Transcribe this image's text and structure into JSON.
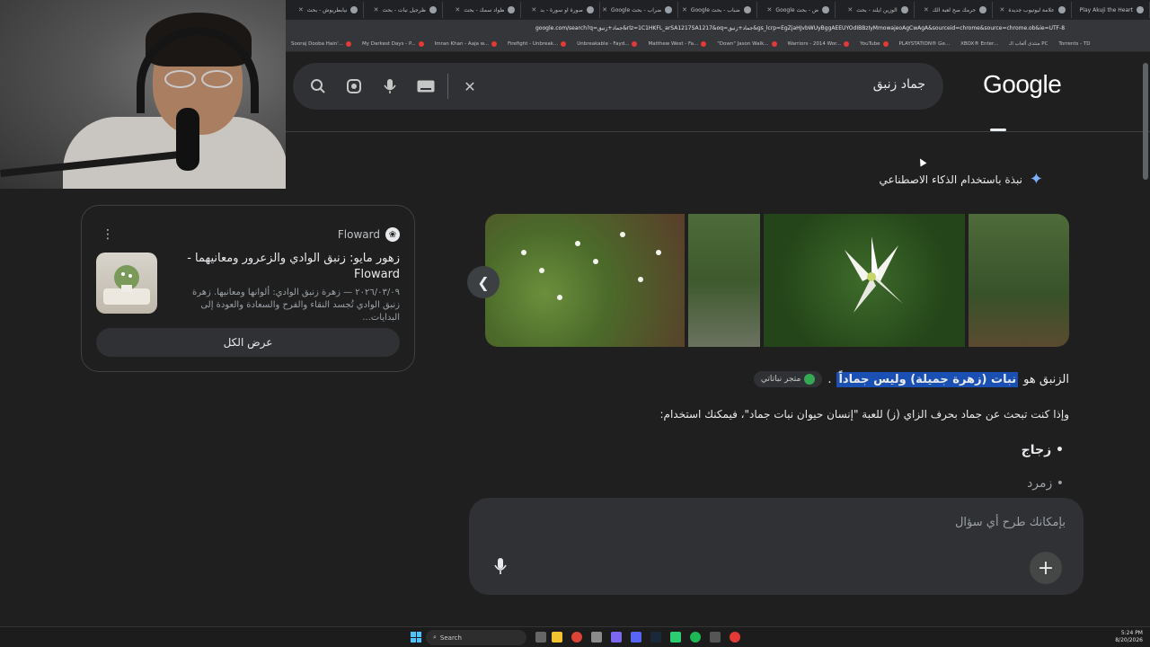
{
  "browser": {
    "tabs": [
      "Play Akuji the Heart",
      "علامة ليوتيوب جديدة",
      "حرمك صح لعبة الك",
      "الوزين ايلند - بحث",
      "ض - بحث Google",
      "ضباب - بحث Google",
      "ضراب - بحث Google",
      "صورة او سورة - بد",
      "ظواد سمك - بحث",
      "ظرجيل نبات - بحث",
      "نيابطريوش - بحث"
    ],
    "url": "google.com/search?q=جماد+زنبق&rlz=1C1HKFL_arSA1217SA1217&oq=جماد+زنبق&gs_lcrp=EgZjaHJvbWUyBggAEEUYOdIBBzIyMmowajeoAgCwAgA&sourceid=chrome&source=chrome.ob&ie=UTF-8",
    "bookmarks": [
      "Torrents - TD",
      "منتدى ألعاب الـ PC",
      "XBOX® Enter...",
      "PLAYSTATION® Ge...",
      "YouTube",
      "Warriors - 2014 Wor...",
      "\"Down\" Jason Walk...",
      "Matthew West - Fa...",
      "Unbreakable - Fayd...",
      "Firefight - Unbreak...",
      "Imran Khan - Aaja w...",
      "My Darkest Days - P...",
      "Sooraj Dooba Hain'..."
    ]
  },
  "search": {
    "query": "جماد زنبق",
    "logo": "Google"
  },
  "ai_overview": {
    "label": "نبذة باستخدام الذكاء الاصطناعي",
    "answer_prefix": "الزنبق هو",
    "answer_highlight": "نبات (زهرة جميلة) وليس جماداً",
    "answer_suffix": ".",
    "source_chip": "متجر نباتاتي",
    "line2": "وإذا كنت تبحث عن جماد بحرف الزاي (ز) للعبة \"إنسان حيوان نبات جماد\"، فيمكنك استخدام:",
    "bullets": [
      "زجاج",
      "زمرد"
    ]
  },
  "followup": {
    "placeholder": "بإمكانك طرح أي سؤال"
  },
  "side_card": {
    "source": "Floward",
    "title": "زهور مايو: زنبق الوادي والزعرور ومعانيهما - Floward",
    "snippet": "٢٠٢٦/٠٣/٠٩ — زهرة زنبق الوادي: ألوانها ومعانيها. زهرة زنبق الوادي تُجسد النقاء والفرح والسعادة والعودة إلى البدايات...",
    "show_all": "عرض الكل"
  },
  "taskbar": {
    "search": "Search",
    "time": "5:24 PM",
    "date": "8/20/2026"
  },
  "colors": {
    "background": "#1f1f1f",
    "highlight": "#1a4fb3",
    "surface": "#303134"
  }
}
